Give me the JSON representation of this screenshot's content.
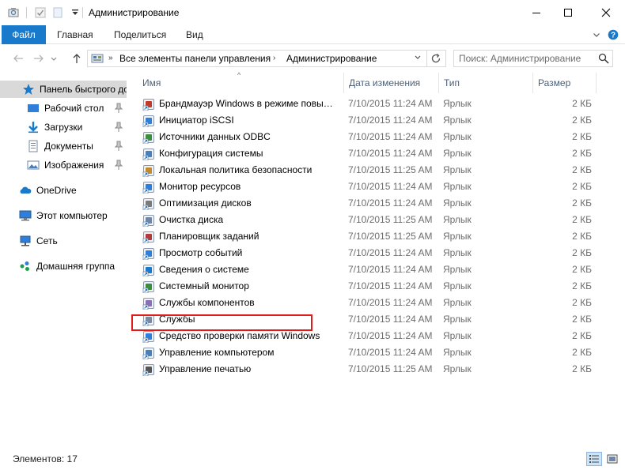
{
  "window": {
    "title": "Администрирование",
    "controls": {
      "minimize": "minimize-icon",
      "maximize": "maximize-icon",
      "close": "close-icon"
    }
  },
  "ribbon": {
    "tabs": [
      {
        "label": "Файл",
        "active": true
      },
      {
        "label": "Главная"
      },
      {
        "label": "Поделиться"
      },
      {
        "label": "Вид"
      }
    ]
  },
  "address": {
    "crumbs": [
      "Все элементы панели управления",
      "Администрирование"
    ],
    "search_placeholder": "Поиск: Администрирование"
  },
  "nav": {
    "quick_access": [
      {
        "label": "Панель быстрого доступа",
        "icon": "star-icon"
      },
      {
        "label": "Рабочий стол",
        "icon": "desktop-icon",
        "pinned": true
      },
      {
        "label": "Загрузки",
        "icon": "download-icon",
        "pinned": true
      },
      {
        "label": "Документы",
        "icon": "documents-icon",
        "pinned": true
      },
      {
        "label": "Изображения",
        "icon": "pictures-icon",
        "pinned": true
      }
    ],
    "locations": [
      {
        "label": "OneDrive",
        "icon": "onedrive-icon"
      },
      {
        "label": "Этот компьютер",
        "icon": "computer-icon"
      },
      {
        "label": "Сеть",
        "icon": "network-icon"
      },
      {
        "label": "Домашняя группа",
        "icon": "homegroup-icon"
      }
    ]
  },
  "columns": {
    "name": "Имя",
    "date": "Дата изменения",
    "type": "Тип",
    "size": "Размер"
  },
  "files": [
    {
      "name": "Брандмауэр Windows в режиме повышенной безопасности",
      "date": "7/10/2015 11:24 AM",
      "type": "Ярлык",
      "size": "2 КБ"
    },
    {
      "name": "Инициатор iSCSI",
      "date": "7/10/2015 11:24 AM",
      "type": "Ярлык",
      "size": "2 КБ"
    },
    {
      "name": "Источники данных ODBC",
      "date": "7/10/2015 11:24 AM",
      "type": "Ярлык",
      "size": "2 КБ"
    },
    {
      "name": "Конфигурация системы",
      "date": "7/10/2015 11:24 AM",
      "type": "Ярлык",
      "size": "2 КБ"
    },
    {
      "name": "Локальная политика безопасности",
      "date": "7/10/2015 11:25 AM",
      "type": "Ярлык",
      "size": "2 КБ"
    },
    {
      "name": "Монитор ресурсов",
      "date": "7/10/2015 11:24 AM",
      "type": "Ярлык",
      "size": "2 КБ"
    },
    {
      "name": "Оптимизация дисков",
      "date": "7/10/2015 11:24 AM",
      "type": "Ярлык",
      "size": "2 КБ"
    },
    {
      "name": "Очистка диска",
      "date": "7/10/2015 11:25 AM",
      "type": "Ярлык",
      "size": "2 КБ"
    },
    {
      "name": "Планировщик заданий",
      "date": "7/10/2015 11:25 AM",
      "type": "Ярлык",
      "size": "2 КБ"
    },
    {
      "name": "Просмотр событий",
      "date": "7/10/2015 11:24 AM",
      "type": "Ярлык",
      "size": "2 КБ"
    },
    {
      "name": "Сведения о системе",
      "date": "7/10/2015 11:24 AM",
      "type": "Ярлык",
      "size": "2 КБ"
    },
    {
      "name": "Системный монитор",
      "date": "7/10/2015 11:24 AM",
      "type": "Ярлык",
      "size": "2 КБ"
    },
    {
      "name": "Службы компонентов",
      "date": "7/10/2015 11:24 AM",
      "type": "Ярлык",
      "size": "2 КБ"
    },
    {
      "name": "Службы",
      "date": "7/10/2015 11:24 AM",
      "type": "Ярлык",
      "size": "2 КБ",
      "highlighted": true
    },
    {
      "name": "Средство проверки памяти Windows",
      "date": "7/10/2015 11:24 AM",
      "type": "Ярлык",
      "size": "2 КБ"
    },
    {
      "name": "Управление компьютером",
      "date": "7/10/2015 11:24 AM",
      "type": "Ярлык",
      "size": "2 КБ"
    },
    {
      "name": "Управление печатью",
      "date": "7/10/2015 11:25 AM",
      "type": "Ярлык",
      "size": "2 КБ"
    }
  ],
  "status": {
    "count": "Элементов: 17"
  },
  "colors": {
    "accent": "#1979ca",
    "highlight": "#e01b1b",
    "selected": "#d9d9d9"
  }
}
